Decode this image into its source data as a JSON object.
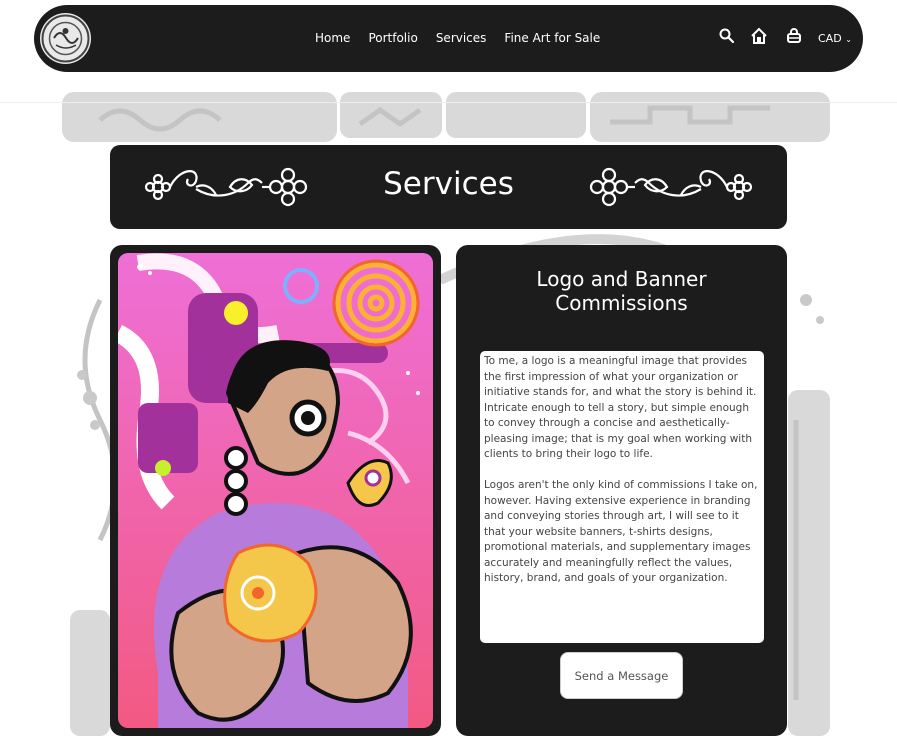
{
  "nav": {
    "items": [
      {
        "label": "Home"
      },
      {
        "label": "Portfolio"
      },
      {
        "label": "Services"
      },
      {
        "label": "Fine Art for Sale"
      }
    ],
    "currency": "CAD",
    "icons": [
      "search-icon",
      "home-icon",
      "cart-icon",
      "chevron-down-icon"
    ]
  },
  "page": {
    "title": "Services"
  },
  "service": {
    "title_line1": "Logo and Banner",
    "title_line2": "Commissions",
    "paragraph1": "To me, a logo is a meaningful image that provides the first impression of what your organization or initiative stands for, and what the story is behind it. Intricate enough to tell a story, but simple enough to convey through a concise and aesthetically-pleasing image; that is my goal when working with clients to bring their logo to life.",
    "paragraph2": "Logos aren't the only kind of commissions I take on, however. Having extensive experience in branding and conveying stories through art, I will see to it that your website banners, t-shirts designs, promotional materials, and supplementary images accurately and meaningfully reflect the values, history, brand, and goals of your organization.",
    "button_label": "Send a Message"
  },
  "colors": {
    "dark": "#1c1c1c",
    "background_pattern": "#d6d6d6",
    "art_pink": "#f0609a",
    "art_purple": "#a3319c"
  }
}
